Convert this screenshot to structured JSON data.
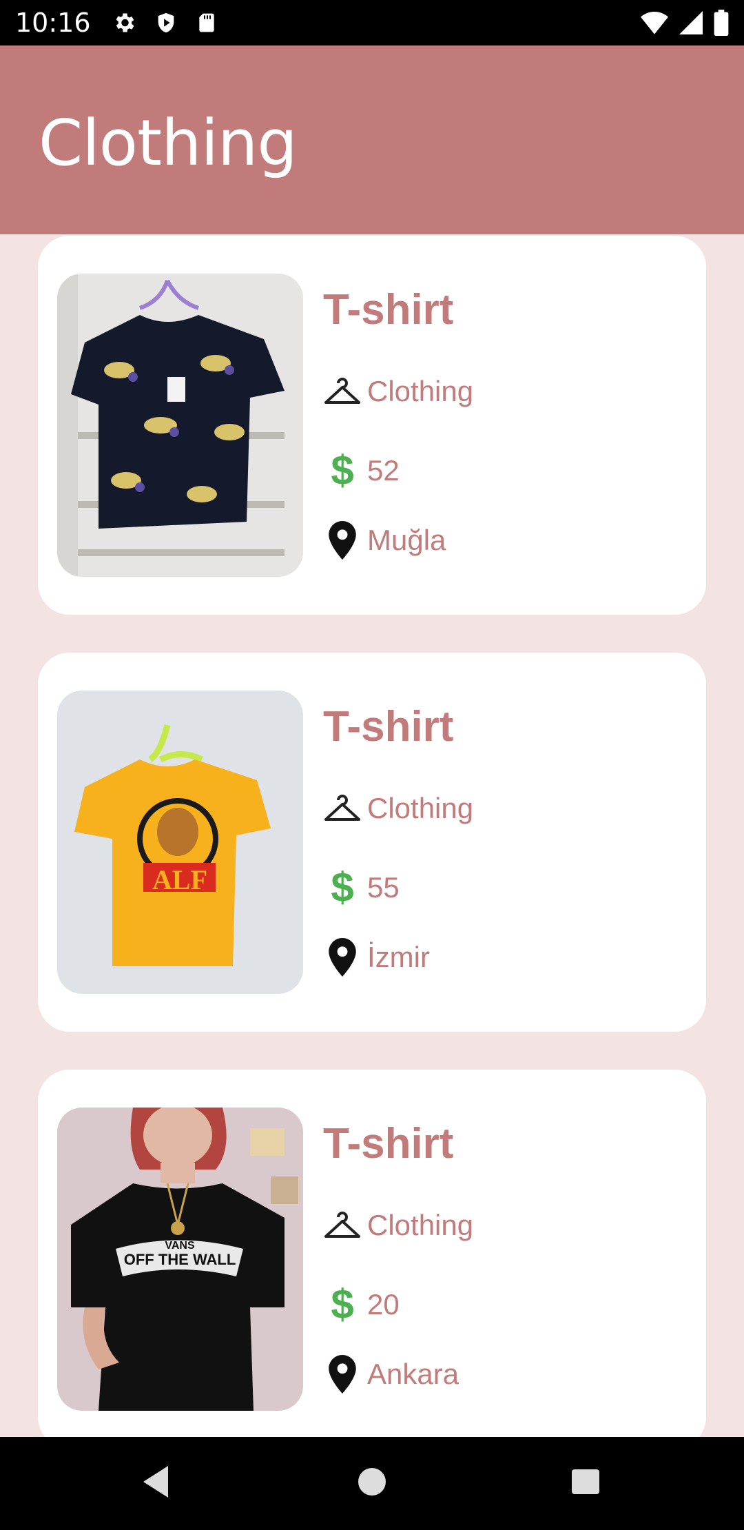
{
  "status_bar": {
    "time": "10:16",
    "left_icons": [
      "gear-icon",
      "shield-play-icon",
      "sd-card-icon"
    ],
    "right_icons": [
      "wifi-icon",
      "signal-icon",
      "battery-icon"
    ]
  },
  "app_bar": {
    "title": "Clothing"
  },
  "items": [
    {
      "title": "T-shirt",
      "category": "Clothing",
      "price": "52",
      "location": "Muğla",
      "image": "black-unicorn-tshirt"
    },
    {
      "title": "T-shirt",
      "category": "Clothing",
      "price": "55",
      "location": "İzmir",
      "image": "yellow-alf-tshirt"
    },
    {
      "title": "T-shirt",
      "category": "Clothing",
      "price": "20",
      "location": "Ankara",
      "image": "black-vans-tshirt"
    }
  ],
  "icons": {
    "category": "hanger-icon",
    "price": "dollar-icon",
    "location": "location-pin-icon"
  },
  "currency_symbol": "$",
  "colors": {
    "accent": "#c27b7b",
    "background": "#f4e3e3",
    "price_icon": "#4caf50"
  },
  "nav_bar": {
    "buttons": [
      "back-button",
      "home-button",
      "recents-button"
    ]
  }
}
